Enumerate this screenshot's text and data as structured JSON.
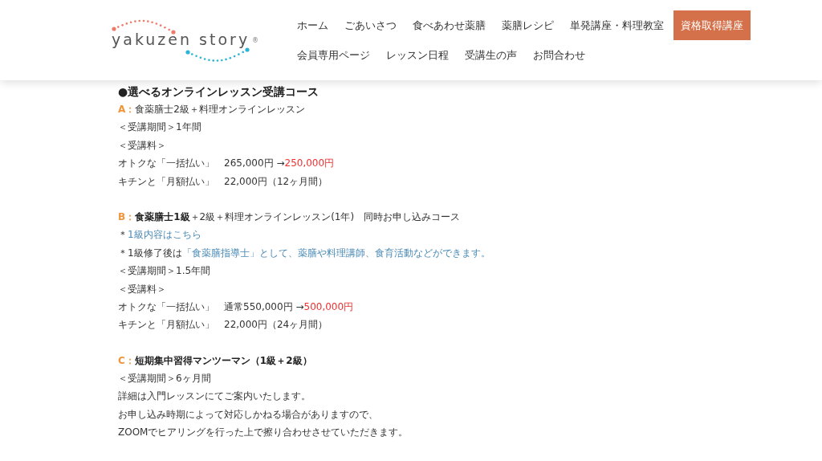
{
  "logo": {
    "text": "yakuzen story",
    "mark": "®"
  },
  "nav": [
    [
      {
        "label": "ホーム",
        "selected": false
      },
      {
        "label": "ごあいさつ",
        "selected": false
      },
      {
        "label": "食べあわせ薬膳",
        "selected": false
      },
      {
        "label": "薬膳レシピ",
        "selected": false
      },
      {
        "label": "単発講座・料理教室",
        "selected": false
      },
      {
        "label": "資格取得講座",
        "selected": true
      }
    ],
    [
      {
        "label": "会員専用ページ",
        "selected": false
      },
      {
        "label": "レッスン日程",
        "selected": false
      },
      {
        "label": "受講生の声",
        "selected": false
      },
      {
        "label": "お問合わせ",
        "selected": false
      }
    ]
  ],
  "heading": "●選べるオンラインレッスン受講コース",
  "blocks": [
    [
      [
        {
          "kind": "label",
          "text": "A："
        },
        {
          "kind": "plain",
          "text": "食薬膳士2級＋料理オンラインレッスン"
        }
      ],
      [
        {
          "kind": "plain",
          "text": "＜受講期間＞1年間"
        }
      ],
      [
        {
          "kind": "plain",
          "text": "＜受講料＞"
        }
      ],
      [
        {
          "kind": "plain",
          "text": "オトクな「一括払い」　265,000円 →"
        },
        {
          "kind": "price",
          "text": "250,000円"
        }
      ],
      [
        {
          "kind": "plain",
          "text": "キチンと「月額払い」　22,000円（12ヶ月間）"
        }
      ]
    ],
    [
      [
        {
          "kind": "label",
          "text": "B："
        },
        {
          "kind": "bold",
          "text": "食薬膳士1級"
        },
        {
          "kind": "plain",
          "text": "＋2級＋料理オンラインレッスン(1年)　同時お申し込みコース"
        }
      ],
      [
        {
          "kind": "plain",
          "text": "＊"
        },
        {
          "kind": "link",
          "text": "1級内容はこちら"
        }
      ],
      [
        {
          "kind": "plain",
          "text": "＊1級修了後は"
        },
        {
          "kind": "link",
          "text": "「食薬膳指導士」として、薬膳や料理講師、食育活動などができます。"
        }
      ],
      [
        {
          "kind": "plain",
          "text": "＜受講期間＞1.5年間"
        }
      ],
      [
        {
          "kind": "plain",
          "text": "＜受講料＞"
        }
      ],
      [
        {
          "kind": "plain",
          "text": "オトクな「一括払い」　通常550,000円 →"
        },
        {
          "kind": "price",
          "text": "500,000円"
        }
      ],
      [
        {
          "kind": "plain",
          "text": "キチンと「月額払い」　22,000円（24ヶ月間）"
        }
      ]
    ],
    [
      [
        {
          "kind": "label",
          "text": "C："
        },
        {
          "kind": "bold",
          "text": "短期集中習得マンツーマン（1級＋2級）"
        }
      ],
      [
        {
          "kind": "plain",
          "text": "＜受講期間＞6ヶ月間"
        }
      ],
      [
        {
          "kind": "plain",
          "text": "詳細は入門レッスンにてご案内いたします。"
        }
      ],
      [
        {
          "kind": "plain",
          "text": "お申し込み時期によって対応しかねる場合がありますので、"
        }
      ],
      [
        {
          "kind": "plain",
          "text": "ZOOMでヒアリングを行った上で擦り合わせさせていただきます。"
        }
      ]
    ]
  ]
}
